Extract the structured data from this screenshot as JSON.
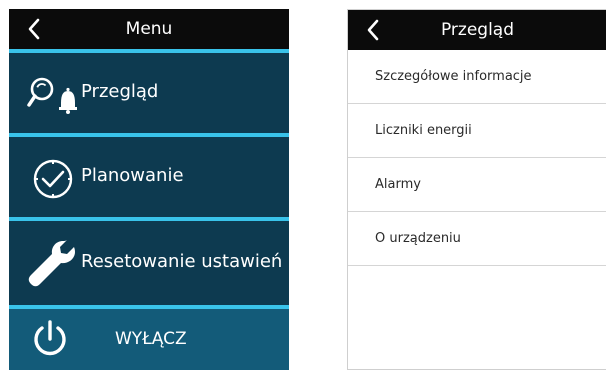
{
  "menu_screen": {
    "title": "Menu",
    "items": [
      {
        "label": "Przegląd",
        "icon": "magnifier-bell-icon"
      },
      {
        "label": "Planowanie",
        "icon": "clock-check-icon"
      },
      {
        "label": "Resetowanie ustawień",
        "icon": "wrench-icon"
      },
      {
        "label": "WYŁĄCZ",
        "icon": "power-icon"
      }
    ]
  },
  "overview_screen": {
    "title": "Przegląd",
    "items": [
      {
        "label": "Szczegółowe informacje"
      },
      {
        "label": "Liczniki energii"
      },
      {
        "label": "Alarmy"
      },
      {
        "label": "O urządzeniu"
      }
    ]
  },
  "colors": {
    "panel_bg": "#0d3a50",
    "accent": "#39c3ea",
    "power_bg": "#135b79",
    "header_bg": "#0b0b0b"
  }
}
